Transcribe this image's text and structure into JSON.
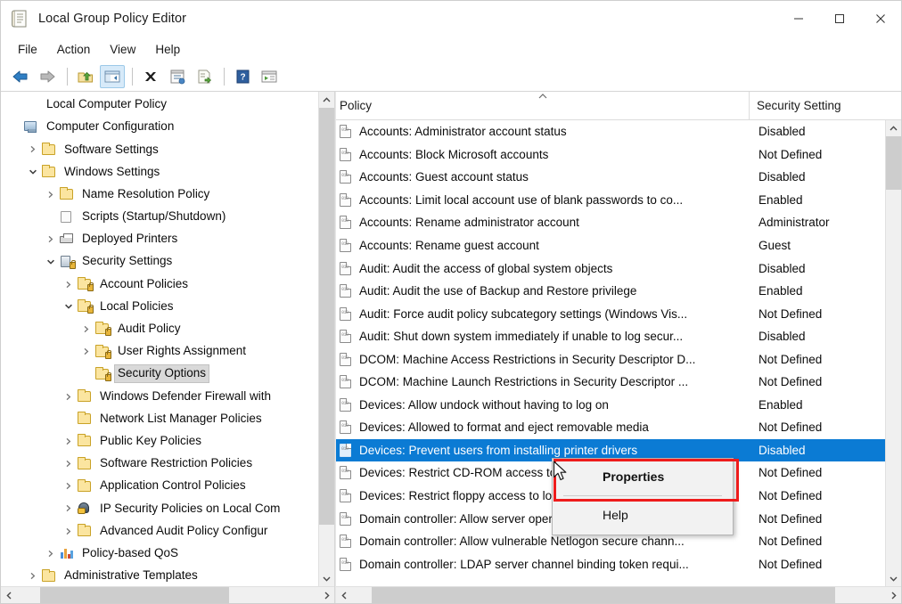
{
  "window": {
    "title": "Local Group Policy Editor",
    "title_icon": "policy-editor-icon",
    "minimize_label": "—",
    "maximize_label": "□",
    "close_label": "✕"
  },
  "menubar": {
    "items": [
      {
        "label": "File",
        "name": "menu-file"
      },
      {
        "label": "Action",
        "name": "menu-action"
      },
      {
        "label": "View",
        "name": "menu-view"
      },
      {
        "label": "Help",
        "name": "menu-help"
      }
    ]
  },
  "toolbar": {
    "buttons": [
      {
        "name": "back-icon",
        "glyph": "←",
        "active": false
      },
      {
        "name": "forward-icon",
        "glyph": "→",
        "active": false
      },
      {
        "name": "up-one-level-icon",
        "glyph": "↑",
        "active": false
      },
      {
        "name": "show-hide-console-tree-icon",
        "glyph": "▤",
        "active": true
      },
      {
        "name": "delete-icon",
        "glyph": "✕",
        "active": false
      },
      {
        "name": "properties-icon",
        "glyph": "▥",
        "active": false
      },
      {
        "name": "export-list-icon",
        "glyph": "▧",
        "active": false
      },
      {
        "name": "help-icon",
        "glyph": "?",
        "active": false
      },
      {
        "name": "filter-icon",
        "glyph": "▶",
        "active": false
      }
    ]
  },
  "tree": {
    "selected": "Security Options",
    "nodes": [
      {
        "label": "Local Computer Policy",
        "indent": 0,
        "chev": "none",
        "icon": "none",
        "name": "tree-node-local-computer-policy"
      },
      {
        "label": "Computer Configuration",
        "indent": 0,
        "chev": "none",
        "icon": "computer",
        "name": "tree-node-computer-configuration"
      },
      {
        "label": "Software Settings",
        "indent": 1,
        "chev": "collapsed",
        "icon": "folder",
        "name": "tree-node-software-settings"
      },
      {
        "label": "Windows Settings",
        "indent": 1,
        "chev": "expanded",
        "icon": "folder",
        "name": "tree-node-windows-settings"
      },
      {
        "label": "Name Resolution Policy",
        "indent": 2,
        "chev": "collapsed",
        "icon": "folder",
        "name": "tree-node-name-resolution-policy"
      },
      {
        "label": "Scripts (Startup/Shutdown)",
        "indent": 2,
        "chev": "none",
        "icon": "script",
        "name": "tree-node-scripts"
      },
      {
        "label": "Deployed Printers",
        "indent": 2,
        "chev": "collapsed",
        "icon": "printer",
        "name": "tree-node-deployed-printers"
      },
      {
        "label": "Security Settings",
        "indent": 2,
        "chev": "expanded",
        "icon": "server",
        "name": "tree-node-security-settings"
      },
      {
        "label": "Account Policies",
        "indent": 3,
        "chev": "collapsed",
        "icon": "folderlock",
        "name": "tree-node-account-policies"
      },
      {
        "label": "Local Policies",
        "indent": 3,
        "chev": "expanded",
        "icon": "folderlock",
        "name": "tree-node-local-policies"
      },
      {
        "label": "Audit Policy",
        "indent": 4,
        "chev": "collapsed",
        "icon": "folderlock",
        "name": "tree-node-audit-policy"
      },
      {
        "label": "User Rights Assignment",
        "indent": 4,
        "chev": "collapsed",
        "icon": "folderlock",
        "name": "tree-node-user-rights-assignment"
      },
      {
        "label": "Security Options",
        "indent": 4,
        "chev": "none",
        "icon": "folderlock",
        "name": "tree-node-security-options",
        "selected": true
      },
      {
        "label": "Windows Defender Firewall with",
        "indent": 3,
        "chev": "collapsed",
        "icon": "folder",
        "name": "tree-node-windows-defender-firewall"
      },
      {
        "label": "Network List Manager Policies",
        "indent": 3,
        "chev": "none",
        "icon": "folder",
        "name": "tree-node-network-list-manager-policies"
      },
      {
        "label": "Public Key Policies",
        "indent": 3,
        "chev": "collapsed",
        "icon": "folder",
        "name": "tree-node-public-key-policies"
      },
      {
        "label": "Software Restriction Policies",
        "indent": 3,
        "chev": "collapsed",
        "icon": "folder",
        "name": "tree-node-software-restriction-policies"
      },
      {
        "label": "Application Control Policies",
        "indent": 3,
        "chev": "collapsed",
        "icon": "folder",
        "name": "tree-node-application-control-policies"
      },
      {
        "label": "IP Security Policies on Local Com",
        "indent": 3,
        "chev": "collapsed",
        "icon": "ipsec",
        "name": "tree-node-ip-security-policies"
      },
      {
        "label": "Advanced Audit Policy Configur",
        "indent": 3,
        "chev": "collapsed",
        "icon": "folder",
        "name": "tree-node-advanced-audit-policy-configuration"
      },
      {
        "label": "Policy-based QoS",
        "indent": 2,
        "chev": "collapsed",
        "icon": "qos",
        "name": "tree-node-policy-based-qos"
      },
      {
        "label": "Administrative Templates",
        "indent": 1,
        "chev": "collapsed",
        "icon": "folder",
        "name": "tree-node-administrative-templates"
      },
      {
        "label": "User Configuration",
        "indent": 0,
        "chev": "collapsed",
        "icon": "computer",
        "name": "tree-node-user-configuration"
      }
    ]
  },
  "listview": {
    "columns": [
      {
        "label": "Policy",
        "name": "column-header-policy",
        "sorted": true,
        "sort_dir": "asc"
      },
      {
        "label": "Security Setting",
        "name": "column-header-security-setting",
        "sorted": false
      }
    ],
    "rows": [
      {
        "policy": "Accounts: Administrator account status",
        "setting": "Disabled"
      },
      {
        "policy": "Accounts: Block Microsoft accounts",
        "setting": "Not Defined"
      },
      {
        "policy": "Accounts: Guest account status",
        "setting": "Disabled"
      },
      {
        "policy": "Accounts: Limit local account use of blank passwords to co...",
        "setting": "Enabled"
      },
      {
        "policy": "Accounts: Rename administrator account",
        "setting": "Administrator"
      },
      {
        "policy": "Accounts: Rename guest account",
        "setting": "Guest"
      },
      {
        "policy": "Audit: Audit the access of global system objects",
        "setting": "Disabled"
      },
      {
        "policy": "Audit: Audit the use of Backup and Restore privilege",
        "setting": "Enabled"
      },
      {
        "policy": "Audit: Force audit policy subcategory settings (Windows Vis...",
        "setting": "Not Defined"
      },
      {
        "policy": "Audit: Shut down system immediately if unable to log secur...",
        "setting": "Disabled"
      },
      {
        "policy": "DCOM: Machine Access Restrictions in Security Descriptor D...",
        "setting": "Not Defined"
      },
      {
        "policy": "DCOM: Machine Launch Restrictions in Security Descriptor ...",
        "setting": "Not Defined"
      },
      {
        "policy": "Devices: Allow undock without having to log on",
        "setting": "Enabled"
      },
      {
        "policy": "Devices: Allowed to format and eject removable media",
        "setting": "Not Defined"
      },
      {
        "policy": "Devices: Prevent users from installing printer drivers",
        "setting": "Disabled",
        "selected": true
      },
      {
        "policy": "Devices: Restrict CD-ROM access to locally logged-on user o...",
        "setting": "Not Defined"
      },
      {
        "policy": "Devices: Restrict floppy access to locally logged-on user only",
        "setting": "Not Defined"
      },
      {
        "policy": "Domain controller: Allow server operators to schedule tasks",
        "setting": "Not Defined"
      },
      {
        "policy": "Domain controller: Allow vulnerable Netlogon secure chann...",
        "setting": "Not Defined"
      },
      {
        "policy": "Domain controller: LDAP server channel binding token requi...",
        "setting": "Not Defined"
      }
    ]
  },
  "context_menu": {
    "items": [
      {
        "label": "Properties",
        "name": "context-menu-properties",
        "bold": true,
        "highlighted": true
      },
      {
        "label": "Help",
        "name": "context-menu-help",
        "bold": false,
        "highlighted": false
      }
    ]
  },
  "colors": {
    "selection_blue": "#0b7bd4",
    "highlight_red": "#ee1c1c",
    "toolbar_active": "#d7eaf9",
    "scrollbar_thumb": "#cdcdcd"
  }
}
